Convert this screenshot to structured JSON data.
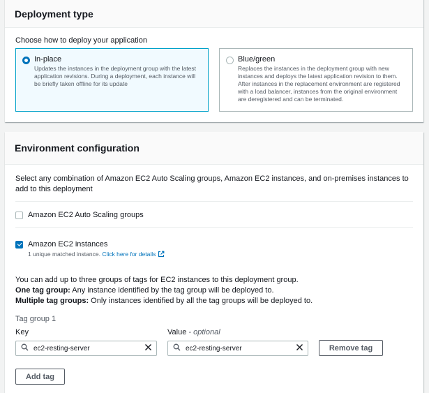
{
  "deployment_type": {
    "title": "Deployment type",
    "choose_label": "Choose how to deploy your application",
    "options": [
      {
        "title": "In-place",
        "description": "Updates the instances in the deployment group with the latest application revisions. During a deployment, each instance will be briefly taken offline for its update",
        "selected": true
      },
      {
        "title": "Blue/green",
        "description": "Replaces the instances in the deployment group with new instances and deploys the latest application revision to them. After instances in the replacement environment are registered with a load balancer, instances from the original environment are deregistered and can be terminated.",
        "selected": false
      }
    ]
  },
  "environment": {
    "title": "Environment configuration",
    "intro": "Select any combination of Amazon EC2 Auto Scaling groups, Amazon EC2 instances, and on-premises instances to add to this deployment",
    "auto_scaling": {
      "label": "Amazon EC2 Auto Scaling groups",
      "checked": false
    },
    "ec2_instances": {
      "label": "Amazon EC2 instances",
      "checked": true,
      "note": "1 unique matched instance.",
      "link": "Click here for details"
    },
    "info": {
      "line1": "You can add up to three groups of tags for EC2 instances to this deployment group.",
      "line2_bold": "One tag group:",
      "line2_rest": " Any instance identified by the tag group will be deployed to.",
      "line3_bold": "Multiple tag groups:",
      "line3_rest": " Only instances identified by all the tag groups will be deployed to."
    },
    "tag_group": {
      "label": "Tag group 1",
      "key_label": "Key",
      "value_label": "Value",
      "value_optional": " - optional",
      "key_value": "ec2-resting-server",
      "value_value": "ec2-resting-server",
      "remove_button": "Remove tag",
      "add_button": "Add tag"
    }
  },
  "colors": {
    "accent": "#0073bb",
    "selected_border": "#00a1c9",
    "selected_bg": "#f1faff",
    "page_bg": "#f2f3f3"
  }
}
